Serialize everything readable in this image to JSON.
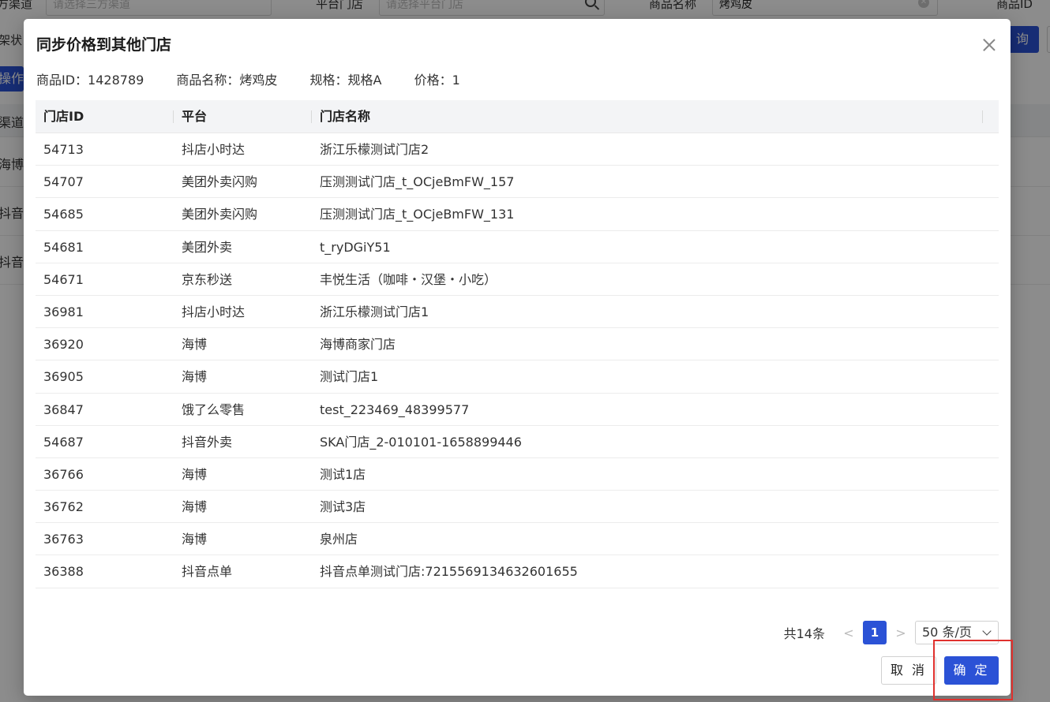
{
  "background": {
    "filters": {
      "channel_label": "方渠道",
      "channel_placeholder": "请选择三方渠道",
      "store_label": "平台门店",
      "store_placeholder": "请选择平台门店",
      "product_name_label": "商品名称",
      "product_name_value": "烤鸡皮",
      "product_id_label": "商品ID",
      "shelf_status_label": "架状",
      "query_button": "询",
      "operation_button": "操作"
    },
    "table": {
      "header_first_col": "渠道",
      "rows": [
        "海博",
        "抖音",
        "抖音"
      ]
    }
  },
  "modal": {
    "title": "同步价格到其他门店",
    "info": {
      "product_id": "商品ID：1428789",
      "product_name": "商品名称：烤鸡皮",
      "spec": "规格：规格A",
      "price": "价格：1"
    },
    "table": {
      "columns": [
        "门店ID",
        "平台",
        "门店名称"
      ],
      "rows": [
        {
          "store_id": "54713",
          "platform": "抖店小时达",
          "store_name": "浙江乐檬测试门店2"
        },
        {
          "store_id": "54707",
          "platform": "美团外卖闪购",
          "store_name": "压测测试门店_t_OCjeBmFW_157"
        },
        {
          "store_id": "54685",
          "platform": "美团外卖闪购",
          "store_name": "压测测试门店_t_OCjeBmFW_131"
        },
        {
          "store_id": "54681",
          "platform": "美团外卖",
          "store_name": "t_ryDGiY51"
        },
        {
          "store_id": "54671",
          "platform": "京东秒送",
          "store_name": "丰悦生活（咖啡・汉堡・小吃）"
        },
        {
          "store_id": "36981",
          "platform": "抖店小时达",
          "store_name": "浙江乐檬测试门店1"
        },
        {
          "store_id": "36920",
          "platform": "海博",
          "store_name": "海博商家门店"
        },
        {
          "store_id": "36905",
          "platform": "海博",
          "store_name": "测试门店1"
        },
        {
          "store_id": "36847",
          "platform": "饿了么零售",
          "store_name": "test_223469_48399577"
        },
        {
          "store_id": "54687",
          "platform": "抖音外卖",
          "store_name": "SKA门店_2-010101-1658899446"
        },
        {
          "store_id": "36766",
          "platform": "海博",
          "store_name": "测试1店"
        },
        {
          "store_id": "36762",
          "platform": "海博",
          "store_name": "测试3店"
        },
        {
          "store_id": "36763",
          "platform": "海博",
          "store_name": "泉州店"
        },
        {
          "store_id": "36388",
          "platform": "抖音点单",
          "store_name": "抖音点单测试门店:7215569134632601655"
        }
      ]
    },
    "pagination": {
      "total": "共14条",
      "current_page": "1",
      "page_size": "50 条/页"
    },
    "buttons": {
      "cancel": "取 消",
      "confirm": "确 定"
    }
  },
  "colors": {
    "primary": "#2b52d6",
    "highlight": "#e0312e"
  }
}
